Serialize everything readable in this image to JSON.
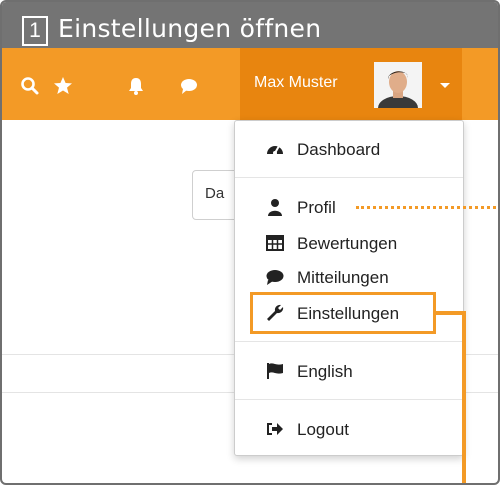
{
  "title": {
    "step": "1",
    "text": "Einstellungen öffnen"
  },
  "navbar": {
    "icons": [
      "search-icon",
      "star-icon",
      "bell-icon",
      "chat-icon"
    ],
    "user_name": "Max Muster",
    "accent": "#f39a26"
  },
  "content": {
    "partial_button": "Da"
  },
  "menu": {
    "items": [
      {
        "label": "Dashboard",
        "icon": "dashboard-icon"
      },
      {
        "label": "Profil",
        "icon": "user-icon"
      },
      {
        "label": "Bewertungen",
        "icon": "table-icon"
      },
      {
        "label": "Mitteilungen",
        "icon": "chat-icon"
      },
      {
        "label": "Einstellungen",
        "icon": "wrench-icon"
      },
      {
        "label": "English",
        "icon": "flag-icon"
      },
      {
        "label": "Logout",
        "icon": "logout-icon"
      }
    ]
  }
}
